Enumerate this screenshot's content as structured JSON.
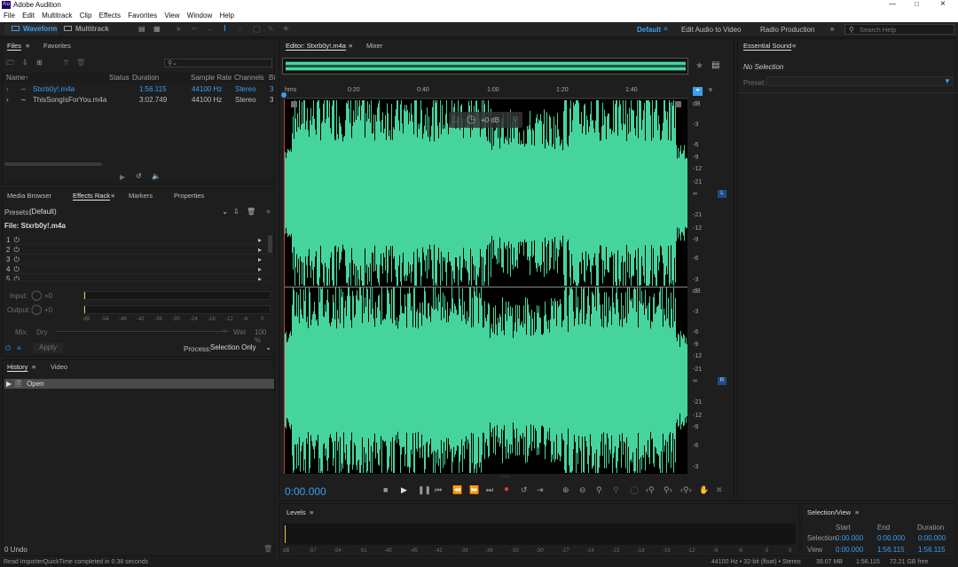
{
  "app": {
    "title": "Adobe Audition",
    "logo": "Au"
  },
  "menu": [
    "File",
    "Edit",
    "Multitrack",
    "Clip",
    "Effects",
    "Favorites",
    "View",
    "Window",
    "Help"
  ],
  "toolbar": {
    "waveform": "Waveform",
    "multitrack": "Multitrack",
    "workspaces": [
      "Default",
      "Edit Audio to Video",
      "Radio Production"
    ],
    "search_placeholder": "Search Help"
  },
  "files_panel": {
    "tabs": [
      "Files",
      "Favorites"
    ],
    "columns": [
      "Name",
      "Status",
      "Duration",
      "Sample Rate",
      "Channels",
      "Bi"
    ],
    "rows": [
      {
        "name": "Stxrb0y!.m4a",
        "status": "",
        "duration": "1:56.115",
        "rate": "44100 Hz",
        "channels": "Stereo",
        "bits": "3"
      },
      {
        "name": "ThisSongIsForYou.m4a",
        "status": "",
        "duration": "3:02.749",
        "rate": "44100 Hz",
        "channels": "Stereo",
        "bits": "3"
      }
    ]
  },
  "effects_panel": {
    "tabs": [
      "Media Browser",
      "Effects Rack",
      "Markers",
      "Properties"
    ],
    "presets_label": "Presets:",
    "preset_value": "(Default)",
    "file_label": "File: Stxrb0y!.m4a",
    "slots": [
      "1",
      "2",
      "3",
      "4",
      "5"
    ],
    "input_label": "Input:",
    "input_value": "+0",
    "output_label": "Output:",
    "output_value": "+0",
    "meter_ticks": [
      "dB",
      "-54",
      "-48",
      "-42",
      "-36",
      "-30",
      "-24",
      "-18",
      "-12",
      "-6",
      "0"
    ],
    "mix_label": "Mix:",
    "dry_label": "Dry",
    "wet_label": "Wet",
    "wet_value": "100 %",
    "apply": "Apply",
    "process_label": "Process:",
    "process_value": "Selection Only"
  },
  "history_panel": {
    "tabs": [
      "History",
      "Video"
    ],
    "items": [
      "Open"
    ],
    "undo": "0 Undo"
  },
  "editor": {
    "tabs": [
      "Editor: Stxrb0y!.m4a",
      "Mixer"
    ],
    "ruler": [
      "hms",
      "0:20",
      "0:40",
      "1:00",
      "1:20",
      "1:40"
    ],
    "gain_hud": "+0 dB",
    "db_top": [
      "dB",
      "-3",
      "-6",
      "-9",
      "-12",
      "-21",
      "∞",
      "-21",
      "-12",
      "-9",
      "-6",
      "-3"
    ],
    "db_bottom": [
      "dB",
      "-3",
      "-6",
      "-9",
      "-12",
      "-21",
      "∞",
      "-21",
      "-12",
      "-9",
      "-6",
      "-3"
    ],
    "channel_l": "L",
    "channel_r": "R",
    "time": "0:00.000"
  },
  "essential_sound": {
    "title": "Essential Sound",
    "selection": "No Selection",
    "preset_label": "Preset:"
  },
  "levels": {
    "title": "Levels",
    "ticks": [
      "dB",
      "-57",
      "-54",
      "-51",
      "-48",
      "-45",
      "-42",
      "-39",
      "-36",
      "-33",
      "-30",
      "-27",
      "-24",
      "-21",
      "-18",
      "-15",
      "-12",
      "-9",
      "-6",
      "-3",
      "0"
    ]
  },
  "selection_view": {
    "title": "Selection/View",
    "cols": [
      "Start",
      "End",
      "Duration"
    ],
    "selection": {
      "label": "Selection",
      "start": "0:00.000",
      "end": "0:00.000",
      "duration": "0:00.000"
    },
    "view": {
      "label": "View",
      "start": "0:00.000",
      "end": "1:56.115",
      "duration": "1:56.115"
    }
  },
  "status_bar": {
    "left": "Read ImporterQuickTime completed in 0.38 seconds",
    "right": [
      "44100 Hz • 32-bit (float) • Stereo",
      "39.07 MB",
      "1:56.115",
      "72.21 GB free"
    ]
  },
  "colors": {
    "accent": "#3c9ef1",
    "waveform": "#46d49d",
    "playhead": "#d23b3b",
    "record": "#e23a3a"
  }
}
